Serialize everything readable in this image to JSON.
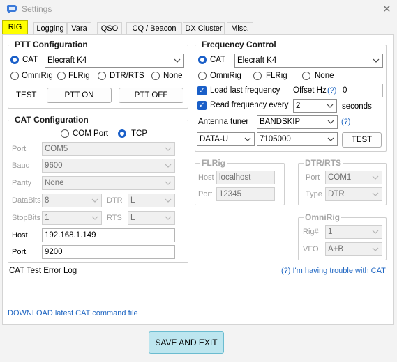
{
  "window": {
    "title": "Settings"
  },
  "tabs": [
    "RIG",
    "Logging",
    "Vara",
    "QSO",
    "CQ / Beacon",
    "DX Cluster",
    "Misc."
  ],
  "ptt": {
    "title": "PTT Configuration",
    "cat_label": "CAT",
    "cat_value": "Elecraft K4",
    "omnirig": "OmniRig",
    "flrig": "FLRig",
    "dtr_rts": "DTR/RTS",
    "none": "None",
    "test": "TEST",
    "ptt_on": "PTT ON",
    "ptt_off": "PTT OFF"
  },
  "cat": {
    "title": "CAT Configuration",
    "com_port": "COM Port",
    "tcp": "TCP",
    "port_label": "Port",
    "port_value": "COM5",
    "baud_label": "Baud",
    "baud_value": "9600",
    "parity_label": "Parity",
    "parity_value": "None",
    "databits_label": "DataBits",
    "databits_value": "8",
    "dtr_label": "DTR",
    "dtr_value": "L",
    "stopbits_label": "StopBits",
    "stopbits_value": "1",
    "rts_label": "RTS",
    "rts_value": "L",
    "host_label": "Host",
    "host_value": "192.168.1.149",
    "tport_label": "Port",
    "tport_value": "9200"
  },
  "freq": {
    "title": "Frequency Control",
    "cat_label": "CAT",
    "cat_value": "Elecraft K4",
    "omnirig": "OmniRig",
    "flrig": "FLRig",
    "none": "None",
    "load_last": "Load last frequency",
    "offset_label": "Offset Hz",
    "offset_help": "(?)",
    "offset_value": "0",
    "read_every": "Read frequency every",
    "read_value": "2",
    "seconds": "seconds",
    "tuner_label": "Antenna tuner",
    "tuner_value": "BANDSKIP",
    "tuner_help": "(?)",
    "mode_value": "DATA-U",
    "freq_value": "7105000",
    "test": "TEST"
  },
  "flrig": {
    "title": "FLRig",
    "host_label": "Host",
    "host_value": "localhost",
    "port_label": "Port",
    "port_value": "12345"
  },
  "dtrrts": {
    "title": "DTR/RTS",
    "port_label": "Port",
    "port_value": "COM1",
    "type_label": "Type",
    "type_value": "DTR"
  },
  "omnirig": {
    "title": "OmniRig",
    "rig_label": "Rig#",
    "rig_value": "1",
    "vfo_label": "VFO",
    "vfo_value": "A+B"
  },
  "log": {
    "label": "CAT Test Error Log",
    "help_link": "(?) I'm having trouble with CAT",
    "download_link": "DOWNLOAD latest CAT command file"
  },
  "footer": {
    "save_exit": "SAVE AND EXIT"
  }
}
